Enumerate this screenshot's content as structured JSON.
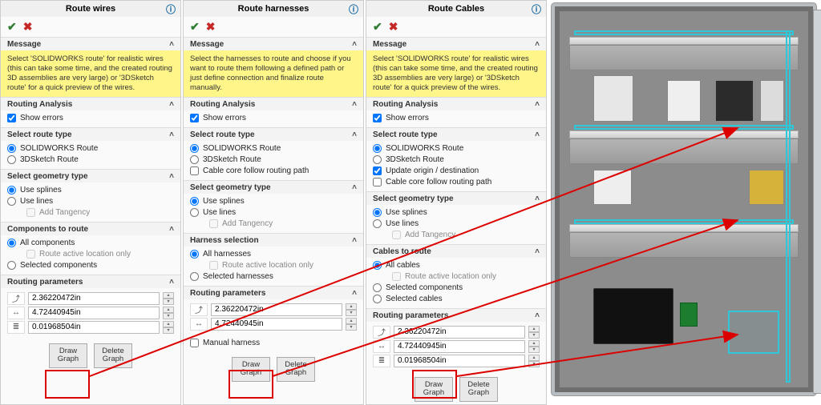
{
  "panels": [
    {
      "title": "Route wires",
      "message": "Select 'SOLIDWORKS route' for realistic wires (this can take some time, and the created routing 3D assemblies are very large) or '3DSketch route' for a quick preview of the wires.",
      "routing_analysis": {
        "label": "Routing Analysis",
        "show_errors": "Show errors",
        "show_errors_checked": true
      },
      "route_type": {
        "label": "Select route type",
        "options": [
          "SOLIDWORKS Route",
          "3DSketch Route"
        ],
        "selected": 0,
        "extras": []
      },
      "geometry": {
        "label": "Select geometry type",
        "options": [
          "Use splines",
          "Use lines"
        ],
        "selected": 0,
        "add_tangency": "Add Tangency"
      },
      "components": {
        "label": "Components to route",
        "options": [
          "All components",
          "Selected components"
        ],
        "selected": 0,
        "active_only": "Route active location only"
      },
      "routing_params": {
        "label": "Routing parameters",
        "values": [
          "2.36220472in",
          "4.72440945in",
          "0.01968504in"
        ]
      },
      "buttons": {
        "draw": "Draw Graph",
        "delete": "Delete Graph"
      }
    },
    {
      "title": "Route harnesses",
      "message": "Select the harnesses to route and choose if you want to route them following a defined path or just define connection and finalize route manually.",
      "routing_analysis": {
        "label": "Routing Analysis",
        "show_errors": "Show errors",
        "show_errors_checked": true
      },
      "route_type": {
        "label": "Select route type",
        "options": [
          "SOLIDWORKS Route",
          "3DSketch Route"
        ],
        "selected": 0,
        "extras": [
          {
            "label": "Cable core follow routing path",
            "checked": false
          }
        ]
      },
      "geometry": {
        "label": "Select geometry type",
        "options": [
          "Use splines",
          "Use lines"
        ],
        "selected": 0,
        "add_tangency": "Add Tangency"
      },
      "components": {
        "label": "Harness selection",
        "options": [
          "All harnesses",
          "Selected harnesses"
        ],
        "selected": 0,
        "active_only": "Route active location only"
      },
      "routing_params": {
        "label": "Routing parameters",
        "values": [
          "2.36220472in",
          "4.72440945in"
        ]
      },
      "manual": {
        "label": "Manual harness",
        "checked": false
      },
      "buttons": {
        "draw": "Draw Graph",
        "delete": "Delete Graph"
      }
    },
    {
      "title": "Route Cables",
      "message": "Select 'SOLIDWORKS route' for realistic wires (this can take some time, and the created routing 3D assemblies are very large) or '3DSketch route' for a quick preview of the wires.",
      "routing_analysis": {
        "label": "Routing Analysis",
        "show_errors": "Show errors",
        "show_errors_checked": true
      },
      "route_type": {
        "label": "Select route type",
        "options": [
          "SOLIDWORKS Route",
          "3DSketch Route"
        ],
        "selected": 0,
        "extras": [
          {
            "label": "Update origin / destination",
            "checked": true
          },
          {
            "label": "Cable core follow routing path",
            "checked": false
          }
        ]
      },
      "geometry": {
        "label": "Select geometry type",
        "options": [
          "Use splines",
          "Use lines"
        ],
        "selected": 0,
        "add_tangency": "Add Tangency"
      },
      "components": {
        "label": "Cables to route",
        "options": [
          "All cables",
          "Selected components",
          "Selected cables"
        ],
        "selected": 0,
        "active_only": "Route active location only"
      },
      "routing_params": {
        "label": "Routing parameters",
        "values": [
          "2.36220472in",
          "4.72440945in",
          "0.01968504in"
        ]
      },
      "buttons": {
        "draw": "Draw Graph",
        "delete": "Delete Graph"
      }
    }
  ],
  "section_label_message": "Message"
}
